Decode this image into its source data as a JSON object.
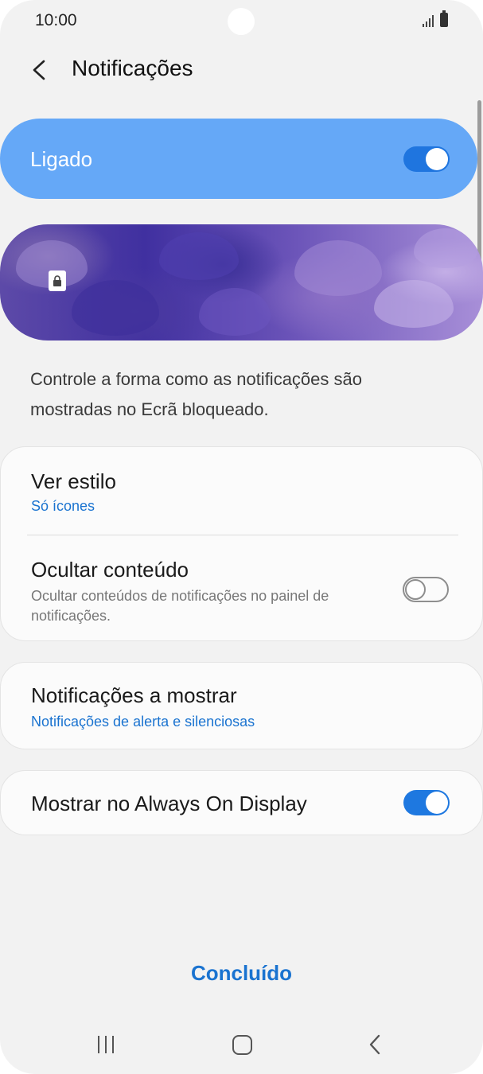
{
  "status_bar": {
    "time": "10:00"
  },
  "header": {
    "title": "Notificações"
  },
  "master": {
    "label": "Ligado",
    "enabled": true
  },
  "description": "Controle a forma como as notificações são mostradas no Ecrã bloqueado.",
  "settings": {
    "view_style": {
      "title": "Ver estilo",
      "value": "Só ícones"
    },
    "hide_content": {
      "title": "Ocultar conteúdo",
      "description": "Ocultar conteúdos de notificações no painel de notificações.",
      "enabled": false
    },
    "notifications_to_show": {
      "title": "Notificações a mostrar",
      "value": "Notificações de alerta e silenciosas"
    },
    "always_on_display": {
      "title": "Mostrar no Always On Display",
      "enabled": true
    }
  },
  "done_label": "Concluído",
  "colors": {
    "accent": "#1a73d0",
    "master_bg": "#65a8f7",
    "toggle_on": "#1e78e0"
  },
  "icons": [
    "back-arrow-icon",
    "signal-icon",
    "battery-icon",
    "lock-icon",
    "recents-icon",
    "home-icon",
    "nav-back-icon"
  ]
}
